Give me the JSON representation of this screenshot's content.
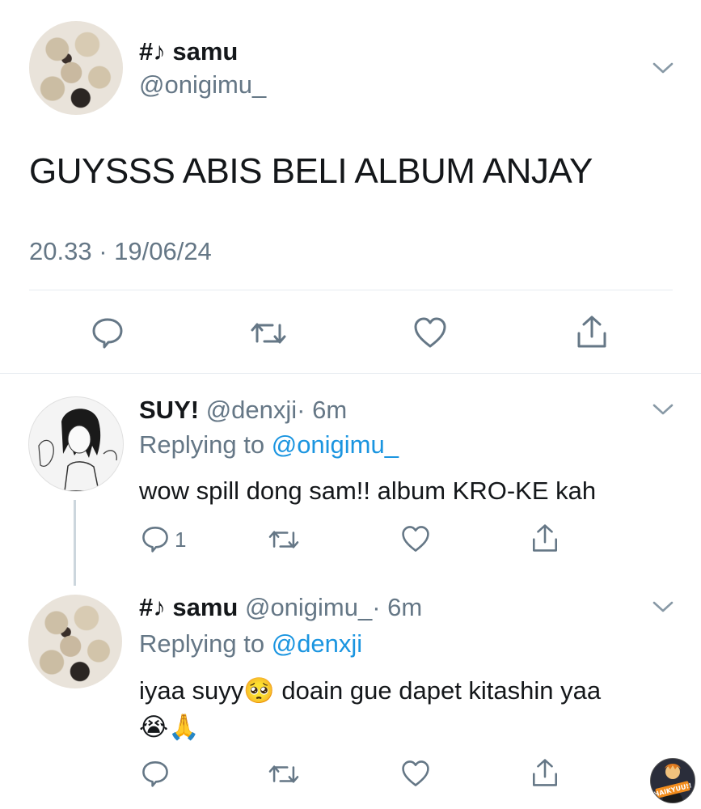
{
  "main_tweet": {
    "display_name": "#♪ samu",
    "handle": "@onigimu_",
    "text": "GUYSSS ABIS BELI ALBUM ANJAY",
    "timestamp": "20.33 · 19/06/24"
  },
  "replies": [
    {
      "display_name": "SUY!",
      "handle": "@denxji",
      "age": "· 6m",
      "replying_prefix": "Replying to",
      "replying_to": "@onigimu_",
      "text": "wow spill dong sam!! album KRO-KE kah",
      "reply_count": "1"
    },
    {
      "display_name": "#♪ samu",
      "handle": "@onigimu_",
      "age": "· 6m",
      "replying_prefix": "Replying to",
      "replying_to": "@denxji",
      "text_line1": "iyaa suyy🥺 doain gue dapet kitashin yaa",
      "text_line2": "😭🙏",
      "reply_count": ""
    }
  ],
  "badge": {
    "label": "HAIKYUU!! FEST"
  },
  "icons": [
    "chevron-down-icon",
    "reply-icon",
    "retweet-icon",
    "like-icon",
    "share-icon"
  ],
  "colors": {
    "text": "#14171a",
    "secondary": "#657786",
    "link": "#1b95e0",
    "icon": "#657786"
  }
}
